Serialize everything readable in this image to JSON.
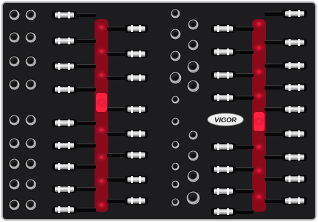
{
  "photo": {
    "brand_logo": {
      "text": "VIGOR"
    },
    "colors": {
      "foam": "#1d1d1f",
      "frame": "#f5f5f5",
      "channel_red": "#d6122e",
      "chrome": "#d9d9d9",
      "logo_bg": "#f0f0f0",
      "logo_text": "#1a1a1a"
    }
  }
}
